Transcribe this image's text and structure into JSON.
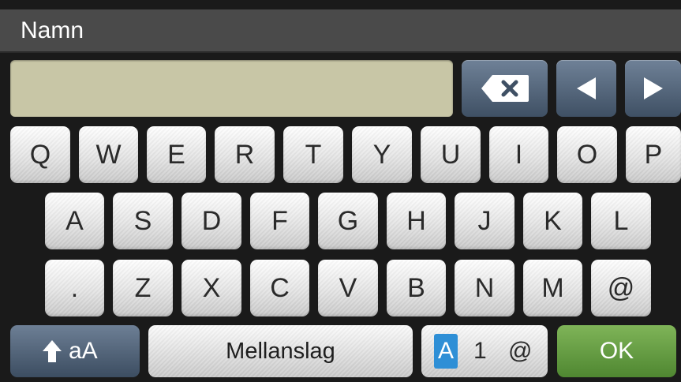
{
  "title": "Namn",
  "input": {
    "value": ""
  },
  "icons": {
    "backspace": "backspace-icon",
    "left": "arrow-left-icon",
    "right": "arrow-right-icon",
    "shift": "shift-up-arrow-icon"
  },
  "keyboard": {
    "row1": [
      "Q",
      "W",
      "E",
      "R",
      "T",
      "Y",
      "U",
      "I",
      "O",
      "P"
    ],
    "row2": [
      "A",
      "S",
      "D",
      "F",
      "G",
      "H",
      "J",
      "K",
      "L"
    ],
    "row3": [
      ".",
      "Z",
      "X",
      "C",
      "V",
      "B",
      "N",
      "M",
      "@"
    ]
  },
  "bottom": {
    "shift_label": "aA",
    "space_label": "Mellanslag",
    "mode_a": "A",
    "mode_1": "1",
    "mode_at": "@",
    "ok_label": "OK"
  },
  "colors": {
    "ok": "#5f9a3c",
    "mode_highlight": "#2e8fd6",
    "entry": "#c8c6a6"
  }
}
